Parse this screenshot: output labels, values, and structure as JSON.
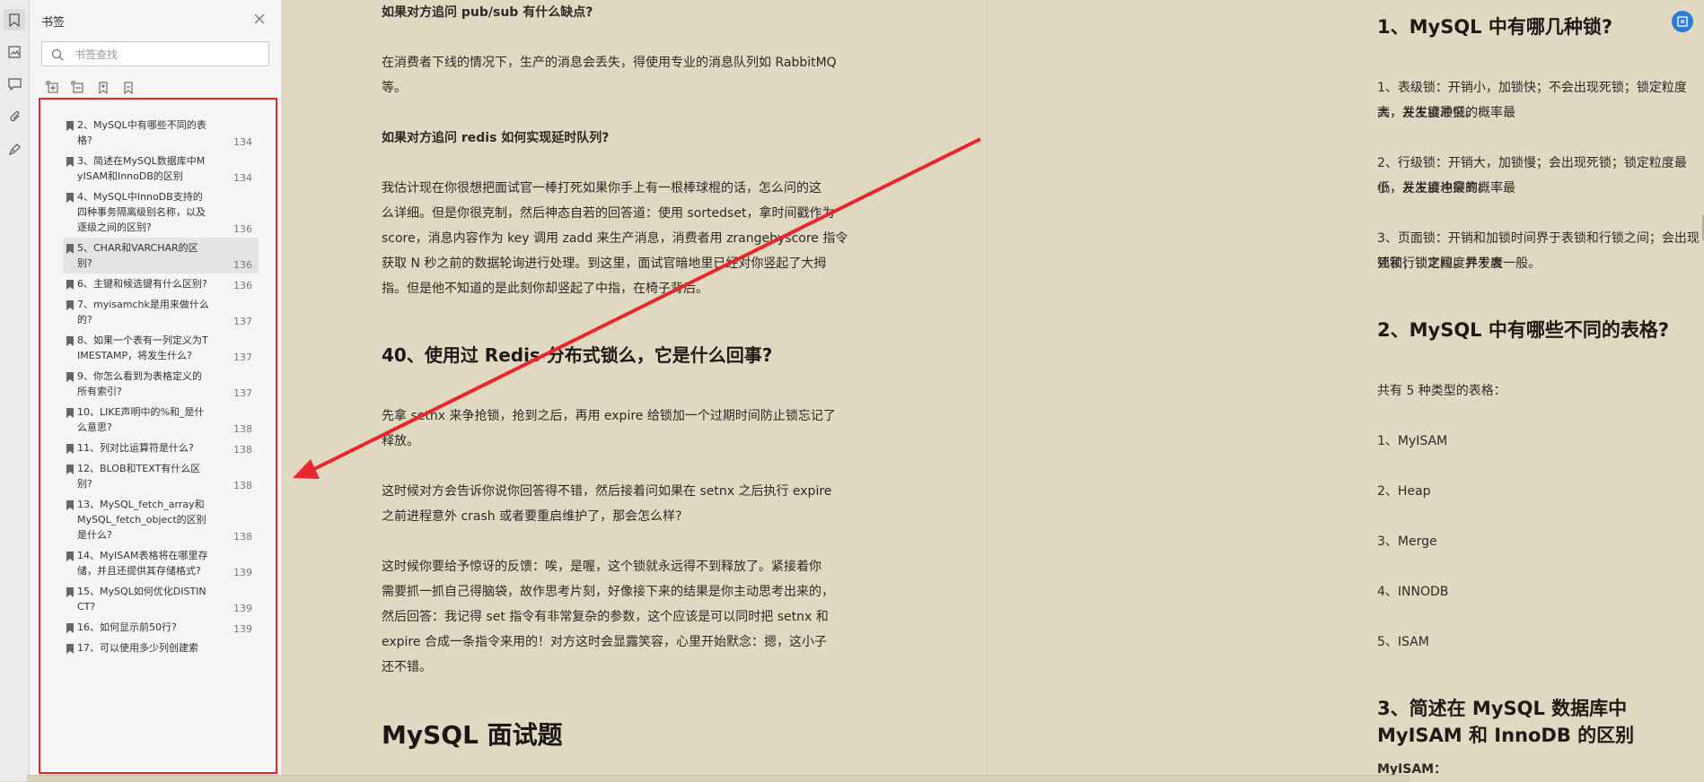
{
  "sidebar": {
    "title": "书签",
    "search_placeholder": "书签查找",
    "items": [
      {
        "label": "2、MySQL中有哪些不同的表格?",
        "page": "134"
      },
      {
        "label": "3、简述在MySQL数据库中MyISAM和InnoDB的区别",
        "page": "134"
      },
      {
        "label": "4、MySQL中InnoDB支持的四种事务隔离级别名称，以及逐级之间的区别?",
        "page": "136"
      },
      {
        "label": "5、CHAR和VARCHAR的区别?",
        "page": "136"
      },
      {
        "label": "6、主键和候选键有什么区别?",
        "page": "136"
      },
      {
        "label": "7、myisamchk是用来做什么的?",
        "page": "137"
      },
      {
        "label": "8、如果一个表有一列定义为TIMESTAMP，将发生什么?",
        "page": "137"
      },
      {
        "label": "9、你怎么看到为表格定义的所有索引?",
        "page": "137"
      },
      {
        "label": "10、LIKE声明中的%和_是什么意思?",
        "page": "138"
      },
      {
        "label": "11、列对比运算符是什么?",
        "page": "138"
      },
      {
        "label": "12、BLOB和TEXT有什么区别?",
        "page": "138"
      },
      {
        "label": "13、MySQL_fetch_array和MySQL_fetch_object的区别是什么?",
        "page": "138"
      },
      {
        "label": "14、MyISAM表格将在哪里存储，并且还提供其存储格式?",
        "page": "139"
      },
      {
        "label": "15、MySQL如何优化DISTINCT?",
        "page": "139"
      },
      {
        "label": "16、如何显示前50行?",
        "page": "139"
      },
      {
        "label": "17、可以使用多少列创建索",
        "page": ""
      }
    ],
    "selected_index": 3
  },
  "left_page": {
    "q1": "如果对方追问 pub/sub 有什么缺点?",
    "p1a": "在消费者下线的情况下，生产的消息会丢失，得使用专业的消息队列如 RabbitMQ",
    "p1b": "等。",
    "q2": "如果对方追问 redis 如何实现延时队列?",
    "p2": [
      "我估计现在你很想把面试官一棒打死如果你手上有一根棒球棍的话，怎么问的这",
      "么详细。但是你很克制，然后神态自若的回答道：使用 sortedset，拿时间戳作为",
      "score，消息内容作为 key 调用 zadd 来生产消息，消费者用 zrangebyscore 指令",
      "获取 N 秒之前的数据轮询进行处理。到这里，面试官暗地里已经对你竖起了大拇",
      "指。但是他不知道的是此刻你却竖起了中指，在椅子背后。"
    ],
    "h40": "40、使用过 Redis 分布式锁么，它是什么回事?",
    "p3": [
      "先拿 setnx 来争抢锁，抢到之后，再用 expire 给锁加一个过期时间防止锁忘记了",
      "释放。"
    ],
    "p4": [
      "这时候对方会告诉你说你回答得不错，然后接着问如果在 setnx 之后执行 expire",
      "之前进程意外 crash 或者要重启维护了，那会怎么样?"
    ],
    "p5": [
      "这时候你要给予惊讶的反馈：唉，是喔，这个锁就永远得不到释放了。紧接着你",
      "需要抓一抓自己得脑袋，故作思考片刻，好像接下来的结果是你主动思考出来的，",
      "然后回答：我记得 set 指令有非常复杂的参数，这个应该是可以同时把 setnx 和",
      "expire 合成一条指令来用的！对方这时会显露笑容，心里开始默念：摁，这小子",
      "还不错。"
    ],
    "section_title": "MySQL 面试题"
  },
  "right_page": {
    "h1": "1、MySQL 中有哪几种锁?",
    "lock1": [
      "1、表级锁：开销小，加锁快；不会出现死锁；锁定粒度大，发生锁冲突的概率最",
      "高，并发度最低。"
    ],
    "lock2": [
      "2、行级锁：开销大，加锁慢；会出现死锁；锁定粒度最小，发生锁冲突的概率最",
      "低，并发度也最高。"
    ],
    "lock3": [
      "3、页面锁：开销和加锁时间界于表锁和行锁之间；会出现死锁；锁定粒度界于表",
      "锁和行锁之间，并发度一般。"
    ],
    "h2": "2、MySQL 中有哪些不同的表格?",
    "intro": "共有 5 种类型的表格：",
    "types": [
      "1、MyISAM",
      "2、Heap",
      "3、Merge",
      "4、INNODB",
      "5、ISAM"
    ],
    "h3": "3、简述在 MySQL 数据库中 MyISAM 和 InnoDB 的区别",
    "sub": "MyISAM："
  },
  "colors": {
    "page_bg": "#e1d8c2",
    "highlight_box": "#e8262b",
    "arrow": "#e8262b",
    "corner_button": "#2f7bd8"
  },
  "icons": {
    "rail": [
      "bookmark-icon",
      "thumbnail-icon",
      "comment-icon",
      "attachment-icon",
      "signature-icon"
    ],
    "toolbar": [
      "expand-all-icon",
      "collapse-all-icon",
      "add-bookmark-icon",
      "bookmark-settings-icon"
    ]
  }
}
